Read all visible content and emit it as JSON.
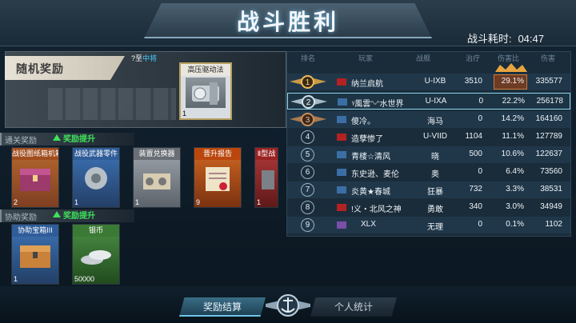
{
  "title": "战斗胜利",
  "battle_time": {
    "label": "战斗耗时:",
    "value": "04:47"
  },
  "random_reward": {
    "label": "随机奖励",
    "upgrade_note": {
      "prefix": "?至",
      "highlight": "中将"
    },
    "item": {
      "name": "高压驱动法",
      "qty": "1"
    }
  },
  "clear_reward": {
    "label": "通关奖励",
    "boost": "奖励提升",
    "items": [
      {
        "name": "战役图纸箱机箱",
        "qty": "2",
        "tone": "purple"
      },
      {
        "name": "战役武器零件",
        "qty": "1",
        "tone": "blue"
      },
      {
        "name": "装置兑换器",
        "qty": "1",
        "tone": "gray"
      },
      {
        "name": "晋升报告",
        "qty": "9",
        "tone": "orange"
      },
      {
        "name": "Ⅱ型战",
        "qty": "1",
        "tone": "red"
      }
    ]
  },
  "assist_reward": {
    "label": "协助奖励",
    "boost": "奖励提升",
    "items": [
      {
        "name": "协助宝箱III",
        "qty": "1",
        "tone": "blue"
      },
      {
        "name": "银币",
        "qty": "50000",
        "tone": "green"
      }
    ]
  },
  "table": {
    "headers": {
      "rank": "排名",
      "player": "玩家",
      "ship": "战舰",
      "heal": "治疗",
      "pct": "伤害比",
      "dmg": "伤害"
    },
    "rows": [
      {
        "rank": "1",
        "player": "纳兰启航",
        "ship": "U-IXB",
        "heal": "3510",
        "pct": "29.1%",
        "dmg": "335577"
      },
      {
        "rank": "2",
        "player": "ᵞ風雲ᵔᵕᵔ水世界",
        "ship": "U-IXA",
        "heal": "0",
        "pct": "22.2%",
        "dmg": "256178"
      },
      {
        "rank": "3",
        "player": "傻冷。",
        "ship": "海马",
        "heal": "0",
        "pct": "14.2%",
        "dmg": "164160"
      },
      {
        "rank": "4",
        "player": "造孽惨了",
        "ship": "U-VIID",
        "heal": "1104",
        "pct": "11.1%",
        "dmg": "127789"
      },
      {
        "rank": "5",
        "player": "青楼☆清风",
        "ship": "晓",
        "heal": "500",
        "pct": "10.6%",
        "dmg": "122637"
      },
      {
        "rank": "6",
        "player": "东史逊、麦伦",
        "ship": "奥",
        "heal": "0",
        "pct": "6.4%",
        "dmg": "73560"
      },
      {
        "rank": "7",
        "player": "炎黄★春城",
        "ship": "狂暴",
        "heal": "732",
        "pct": "3.3%",
        "dmg": "38531"
      },
      {
        "rank": "8",
        "player": "!义・北风之神",
        "ship": "勇敢",
        "heal": "340",
        "pct": "3.0%",
        "dmg": "34949"
      },
      {
        "rank": "9",
        "player": "XLX",
        "ship": "无理",
        "heal": "0",
        "pct": "0.1%",
        "dmg": "1102"
      }
    ]
  },
  "nav": {
    "reward_settle": "奖励结算",
    "personal_stats": "个人统计"
  },
  "colors": {
    "accent": "#6fc3e7",
    "boost": "#3fe05a",
    "gold": "#f0b85a",
    "highlight_text": "#46d0ff"
  }
}
